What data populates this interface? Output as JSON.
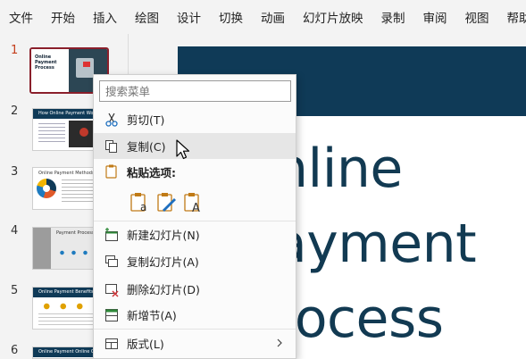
{
  "menubar": {
    "tabs": [
      "文件",
      "开始",
      "插入",
      "绘图",
      "设计",
      "切换",
      "动画",
      "幻灯片放映",
      "录制",
      "审阅",
      "视图",
      "帮助"
    ]
  },
  "thumbnails": [
    {
      "num": "1",
      "selected": true,
      "title_lines": [
        "Online",
        "Payment",
        "Process"
      ]
    },
    {
      "num": "2",
      "header": "How Online Payment Works"
    },
    {
      "num": "3",
      "header": "Online Payment Methods"
    },
    {
      "num": "4",
      "header": "Payment Process"
    },
    {
      "num": "5",
      "header": "Online Payment Benefits"
    },
    {
      "num": "6",
      "header": "Online Payment Online Cost"
    }
  ],
  "slide": {
    "title": "nline\nayment\nrocess",
    "accent_color": "#0f3a57"
  },
  "context_menu": {
    "search_placeholder": "搜索菜单",
    "items": {
      "cut": "剪切(T)",
      "copy": "复制(C)",
      "paste_options": "粘贴选项:",
      "new_slide": "新建幻灯片(N)",
      "duplicate_slide": "复制幻灯片(A)",
      "delete_slide": "删除幻灯片(D)",
      "add_section": "新增节(A)",
      "layout": "版式(L)"
    },
    "paste_options_icons": [
      "paste-use-destination-theme-icon",
      "paste-keep-source-formatting-icon",
      "paste-keep-text-only-icon"
    ]
  }
}
